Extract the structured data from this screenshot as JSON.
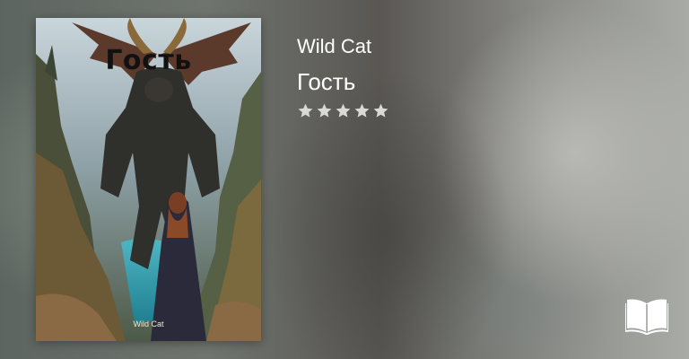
{
  "book": {
    "author": "Wild Cat",
    "title": "Гость",
    "rating": 5,
    "rating_max": 5
  },
  "cover": {
    "title_text": "Гость",
    "author_text": "Wild Cat"
  },
  "colors": {
    "text": "#ffffff",
    "star": "#d9d9d9"
  },
  "icons": {
    "star": "star-icon",
    "book": "open-book-icon"
  }
}
